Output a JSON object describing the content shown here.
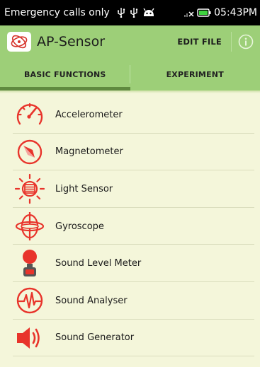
{
  "status_bar": {
    "carrier": "Emergency calls only",
    "clock": "05:43PM"
  },
  "action_bar": {
    "title": "AP-Sensor",
    "edit_file": "EDIT FILE"
  },
  "tabs": [
    {
      "label": "BASIC FUNCTIONS",
      "selected": true
    },
    {
      "label": "EXPERIMENT",
      "selected": false
    }
  ],
  "colors": {
    "accent": "#9dcf78",
    "tab_indicator": "#5f8a3f",
    "icon_red": "#e8342b",
    "background": "#f4f6da"
  },
  "items": [
    {
      "label": "Accelerometer",
      "icon": "speedometer-icon"
    },
    {
      "label": "Magnetometer",
      "icon": "compass-icon"
    },
    {
      "label": "Light Sensor",
      "icon": "light-sensor-icon"
    },
    {
      "label": "Gyroscope",
      "icon": "gyroscope-icon"
    },
    {
      "label": "Sound Level Meter",
      "icon": "sound-level-meter-icon"
    },
    {
      "label": "Sound Analyser",
      "icon": "waveform-icon"
    },
    {
      "label": "Sound Generator",
      "icon": "speaker-icon"
    }
  ]
}
